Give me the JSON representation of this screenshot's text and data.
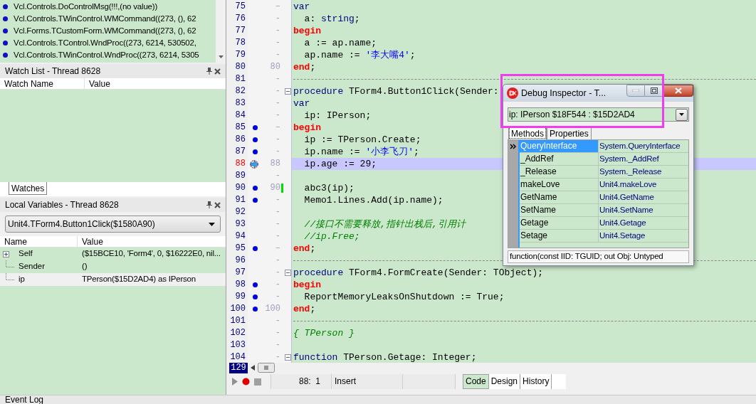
{
  "call_stack": [
    {
      "text": "Vcl.Controls.DoControlMsg(!!!,(no value))"
    },
    {
      "text": "Vcl.Controls.TWinControl.WMCommand((273, (), 62"
    },
    {
      "text": "Vcl.Forms.TCustomForm.WMCommand((273, (), 62"
    },
    {
      "text": "Vcl.Controls.TControl.WndProc((273, 6214, 530502,"
    },
    {
      "text": "Vcl.Controls.TWinControl.WndProc((273, 6214, 5305"
    }
  ],
  "watch_list": {
    "title": "Watch List - Thread 8628",
    "columns": [
      "Watch Name",
      "Value"
    ]
  },
  "panel_tabs": [
    {
      "label": "Watches",
      "selected": true
    }
  ],
  "local_variables": {
    "title": "Local Variables - Thread 8628",
    "frame": "Unit4.TForm4.Button1Click($1580A90)",
    "columns": [
      "Name",
      "Value"
    ],
    "rows": [
      {
        "name": "Self",
        "value": "($15BCE10, 'Form4', 0, $16222E0, nil...",
        "kind": "expandable"
      },
      {
        "name": "Sender",
        "value": "()",
        "kind": "leaf"
      },
      {
        "name": "ip",
        "value": "TPerson($15D2AD4) as IPerson",
        "kind": "leaf"
      }
    ]
  },
  "editor": {
    "lines": [
      {
        "number": "75",
        "gutter": "–",
        "dot": false,
        "current": false,
        "modified": false,
        "tokens": [
          {
            "kind": "kw",
            "text": "var"
          }
        ]
      },
      {
        "number": "76",
        "gutter": "-",
        "dot": false,
        "current": false,
        "modified": false,
        "tokens": [
          {
            "kind": "plain",
            "text": "  a: "
          },
          {
            "kind": "kw",
            "text": "string"
          },
          {
            "kind": "plain",
            "text": ";"
          }
        ]
      },
      {
        "number": "77",
        "gutter": "-",
        "dot": false,
        "current": false,
        "modified": false,
        "tokens": [
          {
            "kind": "block",
            "text": "begin"
          }
        ]
      },
      {
        "number": "78",
        "gutter": "-",
        "dot": false,
        "current": false,
        "modified": false,
        "tokens": [
          {
            "kind": "plain",
            "text": "  a := ap.name;"
          }
        ]
      },
      {
        "number": "79",
        "gutter": "-",
        "dot": false,
        "current": false,
        "modified": false,
        "tokens": [
          {
            "kind": "plain",
            "text": "  ap.name := "
          },
          {
            "kind": "str",
            "text": "'李大嘴4'"
          },
          {
            "kind": "plain",
            "text": ";"
          }
        ]
      },
      {
        "number": "80",
        "gutter": "80",
        "dot": false,
        "current": false,
        "modified": false,
        "tokens": [
          {
            "kind": "block",
            "text": "end"
          },
          {
            "kind": "plain",
            "text": ";"
          }
        ]
      },
      {
        "number": "81",
        "gutter": "-",
        "dot": false,
        "current": false,
        "modified": false,
        "separator": true
      },
      {
        "number": "82",
        "gutter": "-",
        "dot": false,
        "current": false,
        "modified": false,
        "fold": true,
        "tokens": [
          {
            "kind": "kw",
            "text": "procedure"
          },
          {
            "kind": "plain",
            "text": " TForm4.Button1Click(Sender:"
          }
        ]
      },
      {
        "number": "83",
        "gutter": "-",
        "dot": false,
        "current": false,
        "modified": false,
        "tokens": [
          {
            "kind": "kw",
            "text": "var"
          }
        ]
      },
      {
        "number": "84",
        "gutter": "-",
        "dot": false,
        "current": false,
        "modified": false,
        "tokens": [
          {
            "kind": "plain",
            "text": "  ip: IPerson;"
          }
        ]
      },
      {
        "number": "85",
        "gutter": "–",
        "dot": true,
        "current": false,
        "modified": false,
        "tokens": [
          {
            "kind": "block",
            "text": "begin"
          }
        ]
      },
      {
        "number": "86",
        "gutter": "-",
        "dot": true,
        "current": false,
        "modified": false,
        "tokens": [
          {
            "kind": "plain",
            "text": "  ip := TPerson.Create;"
          }
        ]
      },
      {
        "number": "87",
        "gutter": "-",
        "dot": true,
        "current": false,
        "modified": false,
        "tokens": [
          {
            "kind": "plain",
            "text": "  ip.name := "
          },
          {
            "kind": "str",
            "text": "'小李飞刀'"
          },
          {
            "kind": "plain",
            "text": ";"
          }
        ]
      },
      {
        "number": "88",
        "gutter": "88",
        "dot": false,
        "current": true,
        "modified": false,
        "tokens": [
          {
            "kind": "plain",
            "text": "  ip.age := 29;"
          }
        ]
      },
      {
        "number": "89",
        "gutter": "-",
        "dot": false,
        "current": false,
        "modified": false
      },
      {
        "number": "90",
        "gutter": "90",
        "dot": true,
        "current": false,
        "modified": true,
        "tokens": [
          {
            "kind": "plain",
            "text": "  abc3(ip);"
          }
        ]
      },
      {
        "number": "91",
        "gutter": "-",
        "dot": true,
        "current": false,
        "modified": false,
        "tokens": [
          {
            "kind": "plain",
            "text": "  Memo1.Lines.Add(ip.name);"
          }
        ]
      },
      {
        "number": "92",
        "gutter": "-",
        "dot": false,
        "current": false,
        "modified": false
      },
      {
        "number": "93",
        "gutter": "-",
        "dot": false,
        "current": false,
        "modified": false,
        "tokens": [
          {
            "kind": "cmt",
            "text": "  //接口不需要释放,指针出栈后,引用计"
          }
        ]
      },
      {
        "number": "94",
        "gutter": "-",
        "dot": false,
        "current": false,
        "modified": false,
        "tokens": [
          {
            "kind": "cmt",
            "text": "  //ip.Free;"
          }
        ]
      },
      {
        "number": "95",
        "gutter": "–",
        "dot": true,
        "current": false,
        "modified": false,
        "tokens": [
          {
            "kind": "block",
            "text": "end"
          },
          {
            "kind": "plain",
            "text": ";"
          }
        ]
      },
      {
        "number": "96",
        "gutter": "-",
        "dot": false,
        "current": false,
        "modified": false,
        "separator": true
      },
      {
        "number": "97",
        "gutter": "-",
        "dot": false,
        "current": false,
        "modified": false,
        "fold": true,
        "tokens": [
          {
            "kind": "kw",
            "text": "procedure"
          },
          {
            "kind": "plain",
            "text": " TForm4.FormCreate(Sender: TObject);"
          }
        ]
      },
      {
        "number": "98",
        "gutter": "-",
        "dot": true,
        "current": false,
        "modified": false,
        "tokens": [
          {
            "kind": "block",
            "text": "begin"
          }
        ]
      },
      {
        "number": "99",
        "gutter": "-",
        "dot": true,
        "current": false,
        "modified": false,
        "tokens": [
          {
            "kind": "plain",
            "text": "  ReportMemoryLeaksOnShutdown := True;"
          }
        ]
      },
      {
        "number": "100",
        "gutter": "100",
        "dot": true,
        "current": false,
        "modified": false,
        "tokens": [
          {
            "kind": "block",
            "text": "end"
          },
          {
            "kind": "plain",
            "text": ";"
          }
        ]
      },
      {
        "number": "101",
        "gutter": "-",
        "dot": false,
        "current": false,
        "modified": false,
        "separator": true
      },
      {
        "number": "102",
        "gutter": "-",
        "dot": false,
        "current": false,
        "modified": false,
        "tokens": [
          {
            "kind": "cmt",
            "text": "{ TPerson }"
          }
        ]
      },
      {
        "number": "103",
        "gutter": "-",
        "dot": false,
        "current": false,
        "modified": false
      },
      {
        "number": "104",
        "gutter": "-",
        "dot": false,
        "current": false,
        "modified": false,
        "fold": true,
        "tokens": [
          {
            "kind": "kw",
            "text": "function"
          },
          {
            "kind": "plain",
            "text": " TPerson.Getage: Integer;"
          }
        ]
      }
    ],
    "line_count": "129"
  },
  "status_bar": {
    "position": "88:  1",
    "mode": "Insert",
    "tabs": [
      {
        "label": "Code",
        "selected": true
      },
      {
        "label": "Design",
        "selected": false
      },
      {
        "label": "History",
        "selected": false
      }
    ]
  },
  "debug_inspector": {
    "title": "Debug Inspector - T...",
    "expression": "ip: IPerson $18F544 : $15D2AD4",
    "tabs": [
      {
        "label": "Methods",
        "selected": true
      },
      {
        "label": "Properties",
        "selected": false
      }
    ],
    "rows": [
      {
        "name": "QueryInterface",
        "value": "System.QueryInterface",
        "selected": true
      },
      {
        "name": "_AddRef",
        "value": "System._AddRef",
        "selected": false
      },
      {
        "name": "_Release",
        "value": "System._Release",
        "selected": false
      },
      {
        "name": "makeLove",
        "value": "Unit4.makeLove",
        "selected": false
      },
      {
        "name": "GetName",
        "value": "Unit4.GetName",
        "selected": false
      },
      {
        "name": "SetName",
        "value": "Unit4.SetName",
        "selected": false
      },
      {
        "name": "Getage",
        "value": "Unit4.Getage",
        "selected": false
      },
      {
        "name": "Setage",
        "value": "Unit4.Setage",
        "selected": false
      }
    ],
    "footer": "function(const IID: TGUID; out Obj: Untyped"
  },
  "event_log": {
    "title": "Event Log"
  }
}
